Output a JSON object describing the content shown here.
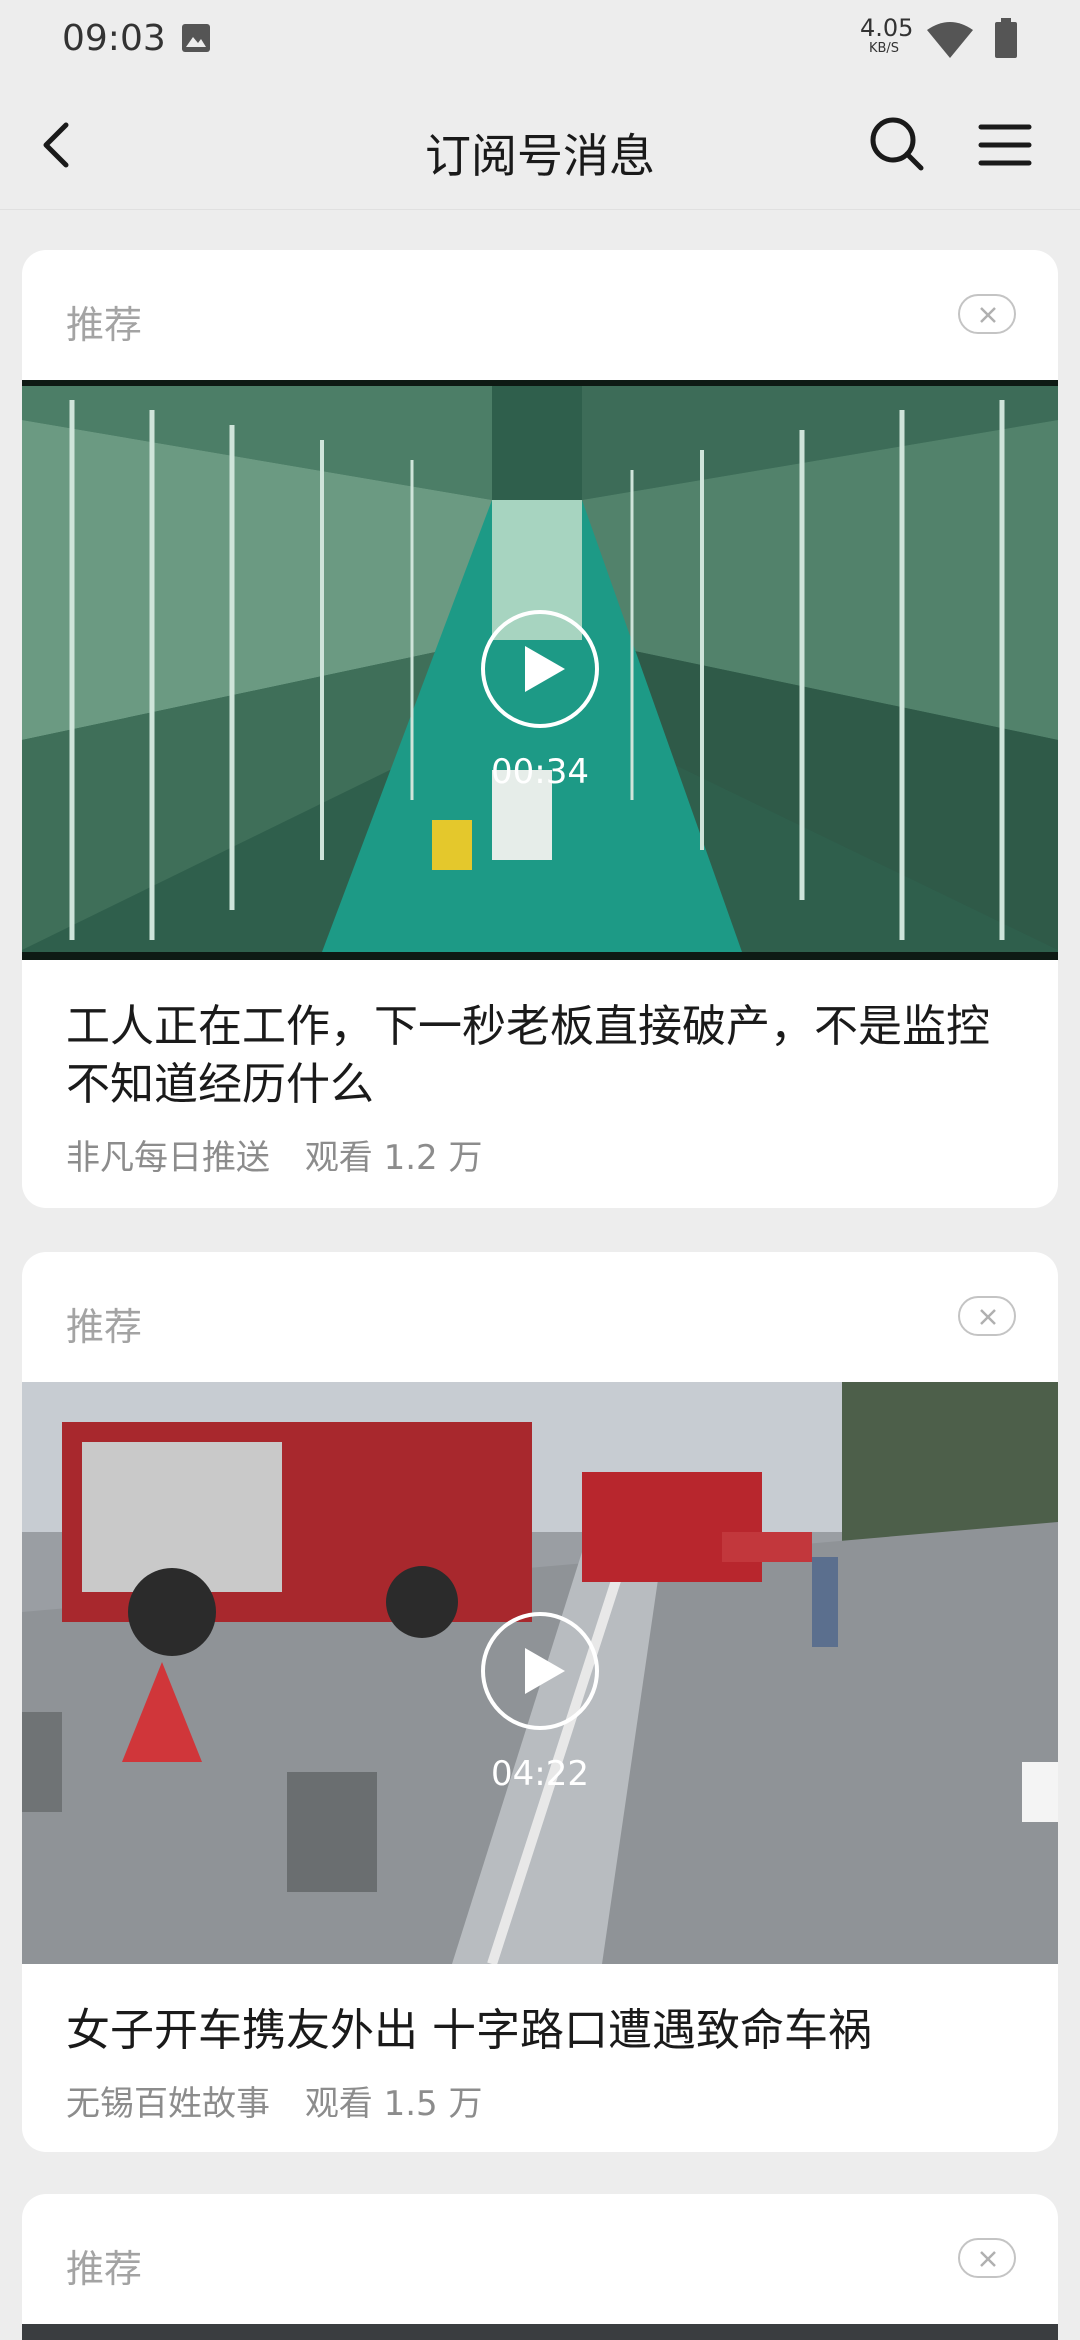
{
  "status_bar": {
    "time": "09:03",
    "net_speed": "4.05",
    "net_unit": "KB/S"
  },
  "nav": {
    "title": "订阅号消息"
  },
  "cards": [
    {
      "tag": "推荐",
      "duration": "00:34",
      "title": "工人正在工作，下一秒老板直接破产，不是监控不知道经历什么",
      "source": "非凡每日推送",
      "views": "观看 1.2 万"
    },
    {
      "tag": "推荐",
      "duration": "04:22",
      "title": "女子开车携友外出 十字路口遭遇致命车祸",
      "source": "无锡百姓故事",
      "views": "观看 1.5 万"
    },
    {
      "tag": "推荐"
    }
  ],
  "icons": {
    "back": "chevron-left-icon",
    "search": "search-icon",
    "menu": "menu-icon",
    "close": "close-icon",
    "play": "play-icon"
  }
}
